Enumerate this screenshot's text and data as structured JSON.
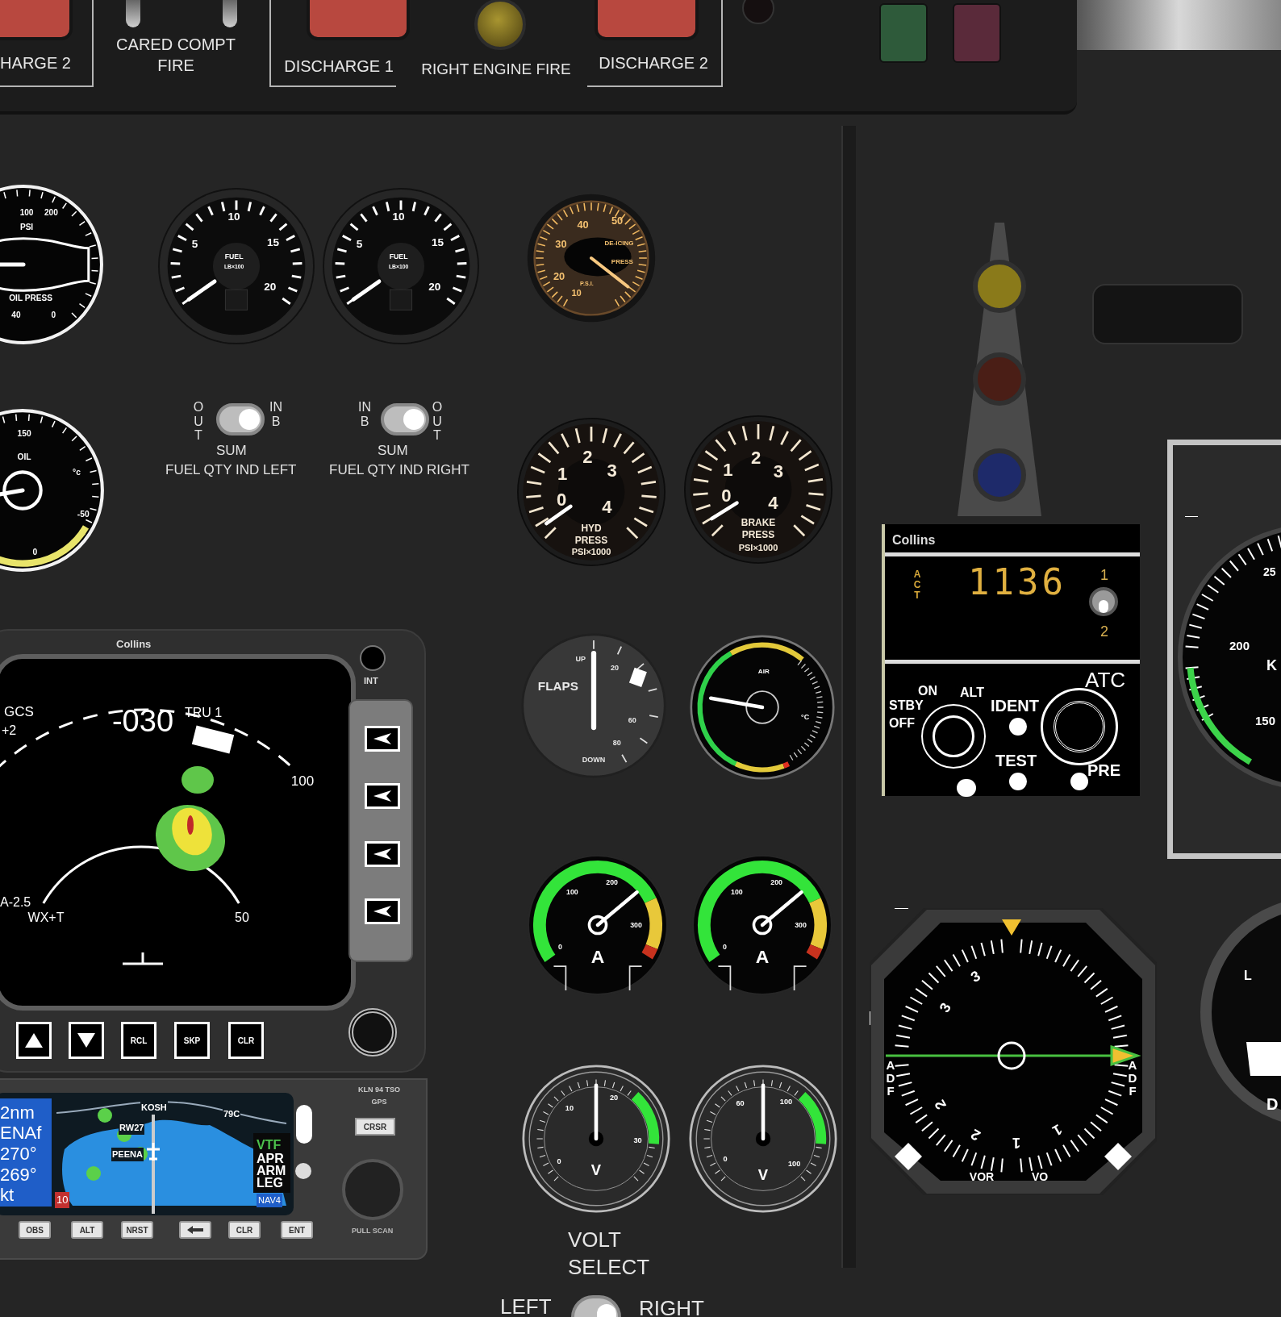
{
  "fire_panel": {
    "items": [
      {
        "kind": "discharge",
        "label": "HARGE 2"
      },
      {
        "kind": "switches",
        "lines": [
          "CARED COMPT",
          "FIRE"
        ],
        "toggles": [
          {
            "on": false
          },
          {
            "on": false
          }
        ]
      },
      {
        "kind": "discharge",
        "label": "DISCHARGE 1"
      },
      {
        "kind": "lamp",
        "label": "RIGHT ENGINE FIRE"
      },
      {
        "kind": "discharge",
        "label": "DISCHARGE 2"
      }
    ]
  },
  "gauges": [
    {
      "kind": "oil_pressure",
      "labels": [
        "100",
        "200",
        "PSI",
        "OIL PRESS",
        "40",
        "0"
      ]
    },
    {
      "kind": "fuel",
      "labels": [
        "5",
        "10",
        "15",
        "20",
        "FUEL",
        "LB×100"
      ]
    },
    {
      "kind": "fuel",
      "labels": [
        "5",
        "10",
        "15",
        "20",
        "FUEL",
        "LB×100"
      ]
    },
    {
      "kind": "deice",
      "labels": [
        "40",
        "50",
        "DE-ICING",
        "30",
        "20",
        "10",
        "P.S.I.",
        "PRESS"
      ]
    },
    {
      "kind": "oil_temp",
      "labels": [
        "150",
        "OIL",
        "°c",
        "-50",
        "0"
      ]
    },
    {
      "kind": "pressure",
      "labels": [
        "1",
        "2",
        "3",
        "0",
        "4",
        "HYD",
        "PRESS",
        "PSI×1000"
      ]
    },
    {
      "kind": "pressure",
      "labels": [
        "1",
        "2",
        "3",
        "0",
        "4",
        "BRAKE",
        "PRESS",
        "PSI×1000"
      ]
    },
    {
      "kind": "flaps",
      "labels": [
        "FLAPS",
        "UP",
        "20",
        "60",
        "80",
        "DOWN"
      ]
    },
    {
      "kind": "air_temp",
      "labels": [
        "AIR",
        "°C"
      ]
    },
    {
      "kind": "ammeter",
      "labels": [
        "100",
        "200",
        "300",
        "0",
        "A"
      ]
    },
    {
      "kind": "ammeter",
      "labels": [
        "100",
        "200",
        "300",
        "0",
        "A"
      ]
    },
    {
      "kind": "voltmeter",
      "labels": [
        "10",
        "20",
        "30",
        "0",
        "V"
      ]
    },
    {
      "kind": "voltmeter",
      "labels": [
        "60",
        "100",
        "0",
        "100",
        "V"
      ]
    }
  ],
  "fuel_qty_switches": [
    {
      "side_a": "OUT",
      "center": "SUM",
      "side_b": "INB",
      "label": "FUEL QTY IND LEFT",
      "on": true
    },
    {
      "side_a": "INB",
      "center": "SUM",
      "side_b": "OUT",
      "label": "FUEL QTY IND RIGHT",
      "on": true
    }
  ],
  "volt_select": {
    "lines": [
      "VOLT",
      "SELECT"
    ],
    "left": "LEFT",
    "right": "RIGHT",
    "on": true
  },
  "weather_radar": {
    "brand": "Collins",
    "knob_label": "INT",
    "readouts": [
      "GCS",
      "+2",
      "-030",
      "TRU 1",
      "100",
      "A-2.5",
      "WX+T",
      "50"
    ],
    "buttons": [
      {
        "kind": "up"
      },
      {
        "kind": "down"
      },
      {
        "kind": "text",
        "label": "RCL"
      },
      {
        "kind": "text",
        "label": "SKP"
      },
      {
        "kind": "text",
        "label": "CLR"
      }
    ]
  },
  "gps": {
    "info_lines": [
      "2nm",
      "ENAf",
      "270°",
      "269°",
      "kt"
    ],
    "alert": "10",
    "map_labels": [
      "KOSH",
      "RW27",
      "PEENA",
      "79C"
    ],
    "modes": [
      {
        "text": "VTF",
        "color": "#4cc24c"
      },
      {
        "text": "APR",
        "color": "#ffffff"
      },
      {
        "text": "ARM",
        "color": "#ffffff"
      },
      {
        "text": "LEG",
        "color": "#ffffff"
      }
    ],
    "nav": "NAV4",
    "buttons": [
      {
        "kind": "text",
        "label": "OBS"
      },
      {
        "kind": "text",
        "label": "ALT"
      },
      {
        "kind": "text",
        "label": "NRST"
      },
      {
        "kind": "arrow"
      },
      {
        "kind": "text",
        "label": "CLR"
      },
      {
        "kind": "text",
        "label": "ENT"
      }
    ],
    "model_lines": [
      "KLN 94 TSO",
      "GPS"
    ],
    "cursor_button": "CRSR",
    "knob_label": "PULL SCAN"
  },
  "transponder": {
    "brand": "Collins",
    "act": "ACT",
    "code": "1136",
    "selector": [
      "1",
      "2"
    ],
    "selector_toggle": {
      "on": true
    },
    "mode_labels": [
      "ON",
      "ALT",
      "STBY",
      "OFF"
    ],
    "ident": "IDENT",
    "test": "TEST",
    "title": "ATC",
    "pre": "PRE"
  },
  "warning_lamps": [
    {
      "color": "#8a7a1a"
    },
    {
      "color": "#4a1e16"
    },
    {
      "color": "#1e2a6a"
    }
  ],
  "airspeed": {
    "labels": [
      "25",
      "200",
      "K",
      "150"
    ]
  },
  "rmi": {
    "card_numbers": [
      "3",
      "3",
      "2",
      "2",
      "1",
      "1"
    ],
    "side_labels": [
      "ADF",
      "ADF"
    ],
    "bottom_labels": [
      "VOR",
      "VO"
    ]
  },
  "partial_gauge": {
    "labels": [
      "L",
      "D"
    ]
  }
}
